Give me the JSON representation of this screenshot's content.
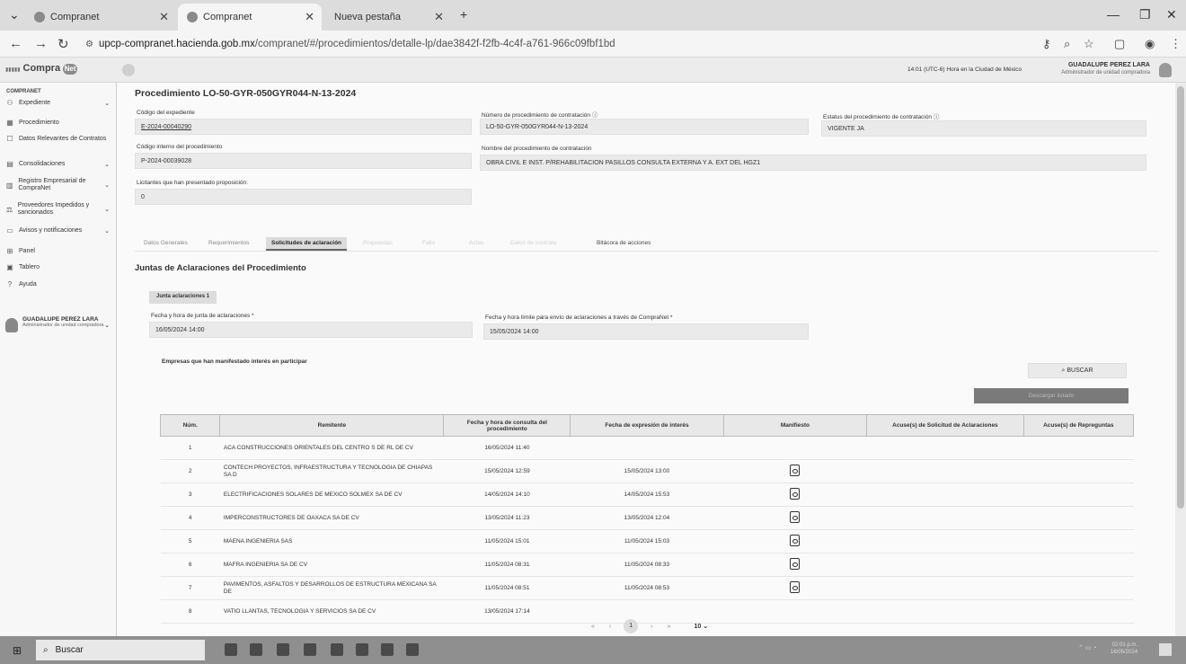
{
  "browser": {
    "tabs": [
      "Compranet",
      "Compranet",
      "Nueva pestaña"
    ],
    "new_tab": "+",
    "url_domain": "upcp-compranet.hacienda.gob.mx",
    "url_path": "/compranet/#/procedimientos/detalle-lp/dae3842f-f2fb-4c4f-a761-966c09fbf1bd"
  },
  "header": {
    "logo": "Compra",
    "logo_mark": "Net",
    "timezone": "14:01 (UTC-6) Hora en la Ciudad de México",
    "user_name": "GUADALUPE PEREZ LARA",
    "user_role": "Administrador de unidad compradora"
  },
  "sidebar": {
    "title": "COMPRANET",
    "items": [
      {
        "icon": "expediente-icon",
        "glyph": "⚇",
        "label": "Expediente",
        "chevron": true
      },
      {
        "icon": "procedimiento-icon",
        "glyph": "▦",
        "label": "Procedimiento",
        "chevron": false
      },
      {
        "icon": "datos-icon",
        "glyph": "☐",
        "label": "Datos Relevantes de Contratos",
        "chevron": false
      },
      {
        "icon": "consolidaciones-icon",
        "glyph": "▤",
        "label": "Consolidaciones",
        "chevron": true
      },
      {
        "icon": "registro-icon",
        "glyph": "▥",
        "label": "Registro Empresarial de CompraNet",
        "chevron": true
      },
      {
        "icon": "proveedores-icon",
        "glyph": "⚖",
        "label": "Proveedores Impedidos y sancionados",
        "chevron": true
      },
      {
        "icon": "avisos-icon",
        "glyph": "▭",
        "label": "Avisos y notificaciones",
        "chevron": true
      },
      {
        "icon": "panel-icon",
        "glyph": "⊞",
        "label": "Panel",
        "chevron": false
      },
      {
        "icon": "tablero-icon",
        "glyph": "▣",
        "label": "Tablero",
        "chevron": false
      },
      {
        "icon": "ayuda-icon",
        "glyph": "?",
        "label": "Ayuda",
        "chevron": false
      }
    ],
    "user_name": "GUADALUPE PEREZ LARA",
    "user_role": "Administrador de unidad compradora"
  },
  "main": {
    "title": "Procedimiento LO-50-GYR-050GYR044-N-13-2024",
    "fields": {
      "codigo_expediente_label": "Código del expediente",
      "codigo_expediente": "E-2024-00040290",
      "numero_proc_label": "Número de procedimiento de contratación",
      "numero_proc": "LO-50-GYR-050GYR044-N-13-2024",
      "estatus_label": "Estatus del procedimiento de contratación",
      "estatus": "VIGENTE JA",
      "codigo_interno_label": "Código interno del procedimiento",
      "codigo_interno": "P-2024-00039028",
      "nombre_proc_label": "Nombre del procedimiento de contratación",
      "nombre_proc": "OBRA CIVIL E INST. P/REHABILITACION PASILLOS CONSULTA EXTERNA Y A. EXT DEL HGZ1",
      "licitantes_label": "Licitantes que han presentado proposición:",
      "licitantes": "0"
    },
    "tabs": [
      "Datos Generales",
      "Requerimientos",
      "Solicitudes de aclaración",
      "Propuestas",
      "Fallo",
      "Actas",
      "Datos de contrato",
      "Bitácora de acciones"
    ],
    "section_title": "Juntas de Aclaraciones del Procedimiento",
    "junta_pill": "Junta aclaraciones 1",
    "fecha_junta_label": "Fecha y hora de junta de aclaraciones *",
    "fecha_junta": "16/05/2024 14:00",
    "fecha_limite_label": "Fecha y hora límite para envío de aclaraciones a través de CompraNet *",
    "fecha_limite": "15/05/2024 14:00",
    "empresas_label": "Empresas que han manifestado interés en participar",
    "buscar": "BUSCAR",
    "descargar": "Descargar listado",
    "table": {
      "headers": [
        "Núm.",
        "Remitente",
        "Fecha y hora de consulta del procedimiento",
        "Fecha de expresión de interés",
        "Manifiesto",
        "Acuse(s) de Solicitud de Aclaraciones",
        "Acuse(s) de Repreguntas"
      ],
      "rows": [
        {
          "num": "1",
          "rem": "ACA CONSTRUCCIONES ORIENTALES DEL CENTRO S DE RL DE CV",
          "consulta": "16/05/2024 11:40",
          "interes": "",
          "pdf": false
        },
        {
          "num": "2",
          "rem": "CONTECH PROYECTOS, INFRAESTRUCTURA Y TECNOLOGIA DE CHIAPAS SA D",
          "consulta": "15/05/2024 12:59",
          "interes": "15/05/2024 13:00",
          "pdf": true
        },
        {
          "num": "3",
          "rem": "ELECTRIFICACIONES SOLARES DE MEXICO SOLMEX SA DE CV",
          "consulta": "14/05/2024 14:10",
          "interes": "14/05/2024 15:53",
          "pdf": true
        },
        {
          "num": "4",
          "rem": "IMPERCONSTRUCTORES DE OAXACA SA DE CV",
          "consulta": "13/05/2024 11:23",
          "interes": "13/05/2024 12:04",
          "pdf": true
        },
        {
          "num": "5",
          "rem": "MAENA INGENIERIA SAS",
          "consulta": "11/05/2024 15:01",
          "interes": "11/05/2024 15:03",
          "pdf": true
        },
        {
          "num": "6",
          "rem": "MAFRA INGENIERIA SA DE CV",
          "consulta": "11/05/2024 08:31",
          "interes": "11/05/2024 08:33",
          "pdf": true
        },
        {
          "num": "7",
          "rem": "PAVIMENTOS, ASFALTOS Y DESARROLLOS DE ESTRUCTURA MEXICANA SA DE",
          "consulta": "11/05/2024 08:51",
          "interes": "11/05/2024 08:53",
          "pdf": true
        },
        {
          "num": "8",
          "rem": "VATIO LLANTAS, TECNOLOGIA Y SERVICIOS SA DE CV",
          "consulta": "13/05/2024 17:14",
          "interes": "",
          "pdf": false
        }
      ]
    },
    "pager": {
      "current": "1",
      "page_size": "10"
    }
  },
  "taskbar": {
    "search": "Buscar",
    "time": "02:01 p.m.",
    "date": "16/05/2024"
  }
}
